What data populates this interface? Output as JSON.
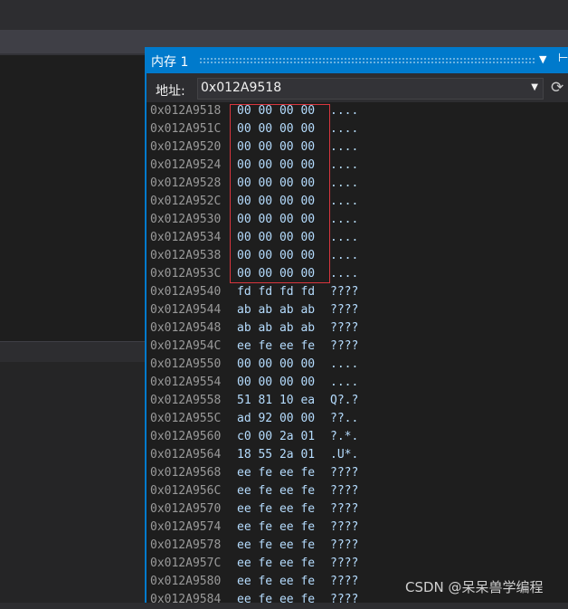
{
  "memory_window": {
    "title": "内存 1",
    "address_label": "地址:",
    "address_value": "0x012A9518"
  },
  "rows": [
    {
      "address": "0x012A9518",
      "bytes": "00 00 00 00",
      "ascii": "...."
    },
    {
      "address": "0x012A951C",
      "bytes": "00 00 00 00",
      "ascii": "...."
    },
    {
      "address": "0x012A9520",
      "bytes": "00 00 00 00",
      "ascii": "...."
    },
    {
      "address": "0x012A9524",
      "bytes": "00 00 00 00",
      "ascii": "...."
    },
    {
      "address": "0x012A9528",
      "bytes": "00 00 00 00",
      "ascii": "...."
    },
    {
      "address": "0x012A952C",
      "bytes": "00 00 00 00",
      "ascii": "...."
    },
    {
      "address": "0x012A9530",
      "bytes": "00 00 00 00",
      "ascii": "...."
    },
    {
      "address": "0x012A9534",
      "bytes": "00 00 00 00",
      "ascii": "...."
    },
    {
      "address": "0x012A9538",
      "bytes": "00 00 00 00",
      "ascii": "...."
    },
    {
      "address": "0x012A953C",
      "bytes": "00 00 00 00",
      "ascii": "...."
    },
    {
      "address": "0x012A9540",
      "bytes": "fd fd fd fd",
      "ascii": "????"
    },
    {
      "address": "0x012A9544",
      "bytes": "ab ab ab ab",
      "ascii": "????"
    },
    {
      "address": "0x012A9548",
      "bytes": "ab ab ab ab",
      "ascii": "????"
    },
    {
      "address": "0x012A954C",
      "bytes": "ee fe ee fe",
      "ascii": "????"
    },
    {
      "address": "0x012A9550",
      "bytes": "00 00 00 00",
      "ascii": "...."
    },
    {
      "address": "0x012A9554",
      "bytes": "00 00 00 00",
      "ascii": "...."
    },
    {
      "address": "0x012A9558",
      "bytes": "51 81 10 ea",
      "ascii": "Q?.?"
    },
    {
      "address": "0x012A955C",
      "bytes": "ad 92 00 00",
      "ascii": "??.."
    },
    {
      "address": "0x012A9560",
      "bytes": "c0 00 2a 01",
      "ascii": "?.*."
    },
    {
      "address": "0x012A9564",
      "bytes": "18 55 2a 01",
      "ascii": ".U*."
    },
    {
      "address": "0x012A9568",
      "bytes": "ee fe ee fe",
      "ascii": "????"
    },
    {
      "address": "0x012A956C",
      "bytes": "ee fe ee fe",
      "ascii": "????"
    },
    {
      "address": "0x012A9570",
      "bytes": "ee fe ee fe",
      "ascii": "????"
    },
    {
      "address": "0x012A9574",
      "bytes": "ee fe ee fe",
      "ascii": "????"
    },
    {
      "address": "0x012A9578",
      "bytes": "ee fe ee fe",
      "ascii": "????"
    },
    {
      "address": "0x012A957C",
      "bytes": "ee fe ee fe",
      "ascii": "????"
    },
    {
      "address": "0x012A9580",
      "bytes": "ee fe ee fe",
      "ascii": "????"
    },
    {
      "address": "0x012A9584",
      "bytes": "ee fe ee fe",
      "ascii": "????"
    }
  ],
  "highlighted_rows": 10,
  "icons": {
    "dropdown": "chevron-down-icon",
    "pin": "pin-icon",
    "refresh": "refresh-icon"
  },
  "watermark": "CSDN @呆呆兽学编程"
}
